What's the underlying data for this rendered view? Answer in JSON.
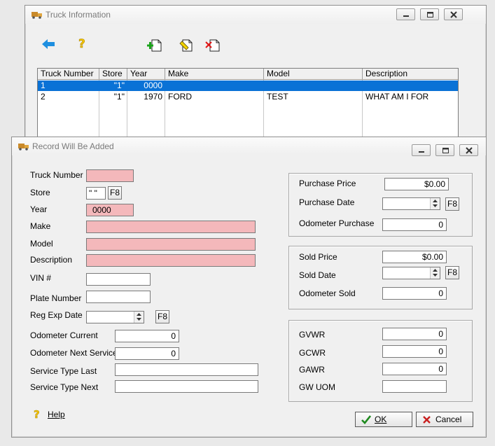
{
  "truck_window": {
    "title": "Truck Information",
    "grid": {
      "columns": [
        "Truck Number",
        "Store",
        "Year",
        "Make",
        "Model",
        "Description"
      ],
      "rows": [
        {
          "truck_number": "1",
          "store": "\"1\"",
          "year": "0000",
          "make": "",
          "model": "",
          "description": ""
        },
        {
          "truck_number": "2",
          "store": "\"1\"",
          "year": "1970",
          "make": "FORD",
          "model": "TEST",
          "description": "WHAT AM I FOR"
        }
      ]
    }
  },
  "record_dialog": {
    "title": "Record Will Be Added",
    "fields": {
      "truck_number_label": "Truck Number",
      "truck_number_value": "",
      "store_label": "Store",
      "store_value": "\" \"",
      "year_label": "Year",
      "year_value": "0000",
      "make_label": "Make",
      "model_label": "Model",
      "description_label": "Description",
      "vin_label": "VIN #",
      "plate_label": "Plate Number",
      "reg_exp_label": "Reg Exp Date",
      "odometer_current_label": "Odometer Current",
      "odometer_current_value": "0",
      "odometer_next_label": "Odometer Next Service",
      "odometer_next_value": "0",
      "service_last_label": "Service Type Last",
      "service_next_label": "Service Type Next"
    },
    "purchase": {
      "price_label": "Purchase Price",
      "price_value": "$0.00",
      "date_label": "Purchase Date",
      "odometer_label": "Odometer Purchase",
      "odometer_value": "0"
    },
    "sold": {
      "price_label": "Sold Price",
      "price_value": "$0.00",
      "date_label": "Sold Date",
      "odometer_label": "Odometer Sold",
      "odometer_value": "0"
    },
    "weights": {
      "gvwr_label": "GVWR",
      "gvwr_value": "0",
      "gcwr_label": "GCWR",
      "gcwr_value": "0",
      "gawr_label": "GAWR",
      "gawr_value": "0",
      "gwuom_label": "GW UOM",
      "gwuom_value": ""
    },
    "f8_label": "F8",
    "help_label": "Help",
    "ok_label": "OK",
    "cancel_label": "Cancel"
  },
  "colors": {
    "selection": "#0a72d6",
    "required_field": "#f4b8bb"
  }
}
